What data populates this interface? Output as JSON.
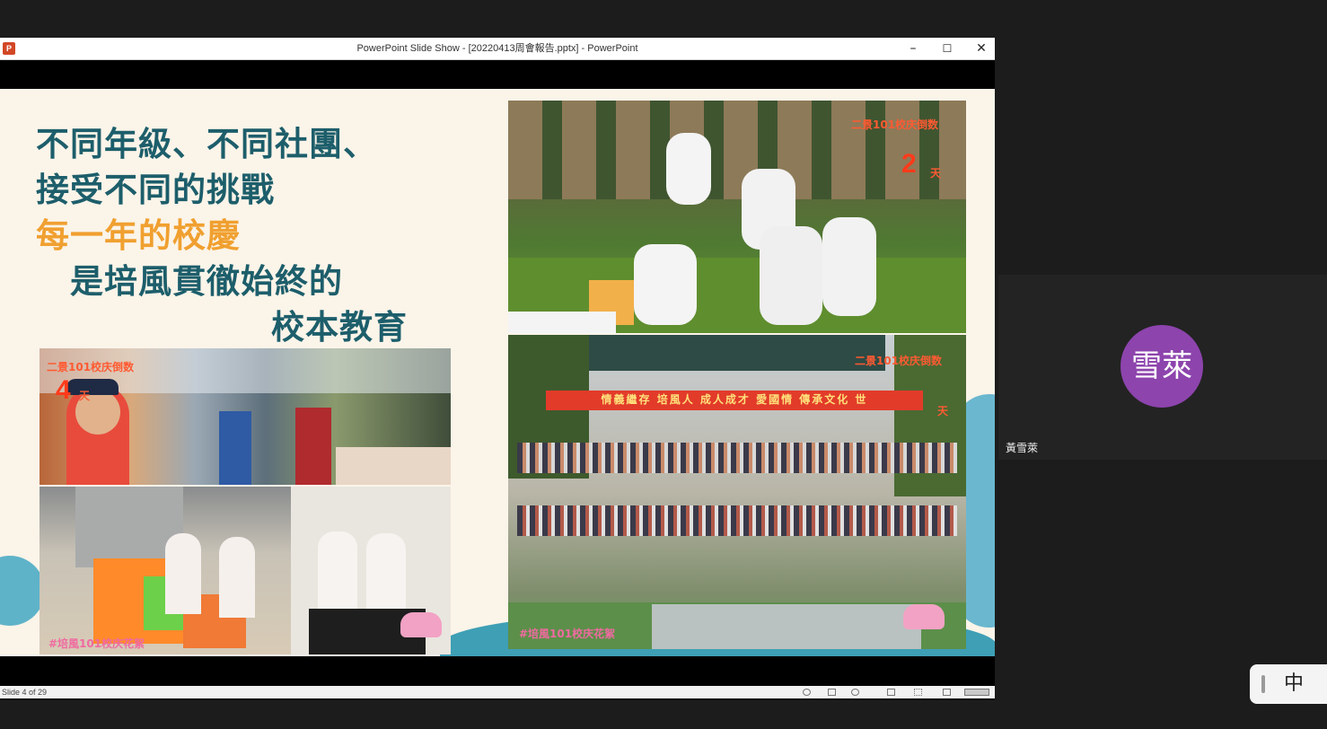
{
  "window": {
    "title": "PowerPoint Slide Show - [20220413周會報告.pptx] - PowerPoint",
    "app_icon": "P",
    "minimize_glyph": "–",
    "maximize_glyph": "☐",
    "close_glyph": "✕"
  },
  "slide": {
    "line1": "不同年級、不同社團、",
    "line2": "接受不同的挑戰",
    "line3": "每一年的校慶",
    "line4": "是培風貫徹始終的",
    "line5": "校本教育",
    "colors": {
      "teal": "#1d5e6b",
      "orange": "#f0a030",
      "background": "#fbf4e9",
      "accent_blue": "#3e9fb5"
    },
    "photos": {
      "food_fair": {
        "caption": "二景101校庆倒数",
        "day_number": "4",
        "day_unit": "天"
      },
      "kitchen": {
        "caption": "#培風101校庆花絮"
      },
      "taekwondo": {
        "caption": "二景101校庆倒数",
        "day_number": "2",
        "day_unit": "天"
      },
      "building": {
        "caption": "二景101校庆倒数",
        "banner": "情義繼存 培風人 成人成才 愛國情 傳承文化 世",
        "day_unit": "天",
        "bottom_caption": "#培風101校庆花絮"
      }
    }
  },
  "status": {
    "slide_counter": "Slide 4 of 29"
  },
  "participant": {
    "avatar_text": "雪萊",
    "name": "黃雪萊",
    "avatar_color": "#8d44ad"
  },
  "ime": {
    "label": "中"
  }
}
